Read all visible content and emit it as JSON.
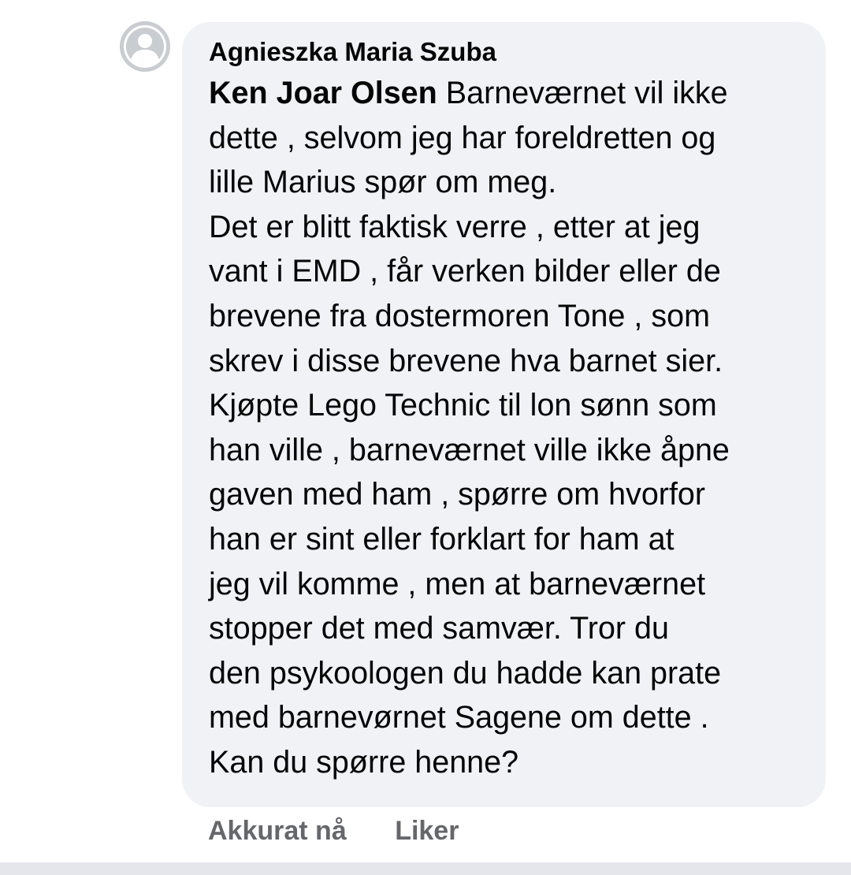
{
  "comment": {
    "author": "Agnieszka Maria Szuba",
    "mention": "Ken Joar Olsen",
    "text": " Barneværnet vil ikke\ndette , selvom jeg har foreldretten og\nlille Marius spør om meg.\nDet er blitt faktisk verre , etter at jeg\nvant i EMD , får verken bilder eller de\nbrevene fra dostermoren Tone , som\nskrev i disse brevene hva barnet sier.\nKjøpte Lego Technic til lon sønn som\nhan ville , barneværnet ville ikke åpne\ngaven med ham , spørre om hvorfor\nhan er sint eller forklart for ham at\njeg vil komme , men at barneværnet\nstopper det med samvær. Tror du\nden psykoologen du hadde kan prate\nmed barnevørnet Sagene om dette .\nKan du spørre henne?",
    "timestamp": "Akkurat nå",
    "like_label": "Liker",
    "avatar_icon": "default-profile-icon"
  },
  "colors": {
    "bubble_bg": "#f0f2f5",
    "text": "#050505",
    "secondary_text": "#65676b",
    "avatar_bg": "#c9ccd1"
  }
}
